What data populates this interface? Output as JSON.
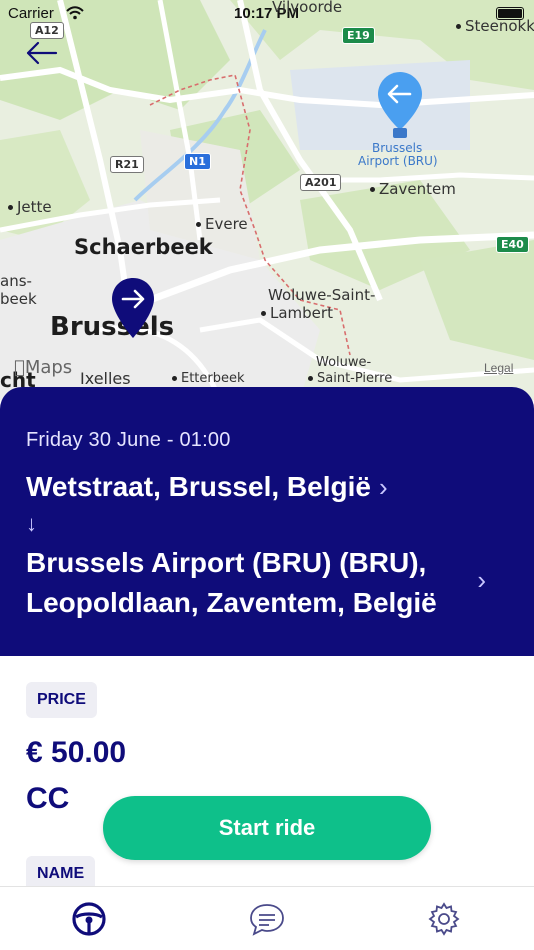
{
  "status_bar": {
    "carrier": "Carrier",
    "time": "10:17 PM"
  },
  "map": {
    "labels": {
      "vilvoorde": "Vilvoorde",
      "steenokkerzeel": "Steenokke",
      "jette": "Jette",
      "evere": "Evere",
      "schaerbeek": "Schaerbeek",
      "zaventem": "Zaventem",
      "brussels_airport_line1": "Brussels",
      "brussels_airport_line2": "Airport (BRU)",
      "brussels": "Brussels",
      "ganshoren_line1": "ans-",
      "ganshoren_line2": "beek",
      "woluwe_lambert_line1": "Woluwe-Saint-",
      "woluwe_lambert_line2": "Lambert",
      "woluwe_pierre_line1": "Woluwe-",
      "woluwe_pierre_line2": "Saint-Pierre",
      "ixelles": "Ixelles",
      "etterbeek": "Etterbeek",
      "cht": "cht"
    },
    "shields": {
      "a12": "A12",
      "e19": "E19",
      "r21": "R21",
      "n1": "N1",
      "a201": "A201",
      "e40": "E40"
    },
    "maps_brand": "Maps",
    "legal": "Legal"
  },
  "ride": {
    "date": "Friday 30 June - 01:00",
    "from": "Wetstraat, Brussel, België",
    "arrow": "↓",
    "to": "Brussels Airport (BRU) (BRU), Leopoldlaan, Zaventem, België",
    "chevron": "›"
  },
  "details": {
    "price_label": "PRICE",
    "price_value": "€ 50.00",
    "payment_value": "CC",
    "name_label": "NAME"
  },
  "actions": {
    "start_ride_label": "Start ride"
  },
  "icons": {
    "back": "arrow-left-icon",
    "pin_start": "arrow-right-pin-icon",
    "pin_end": "arrow-left-pin-icon",
    "tab_rides": "steering-wheel-icon",
    "tab_messages": "chat-bubble-icon",
    "tab_settings": "gear-icon"
  },
  "colors": {
    "primary": "#0f0c7a",
    "accent": "#0ec08a",
    "pin_end": "#4a9ff0",
    "chip_bg": "#eeeef4"
  }
}
